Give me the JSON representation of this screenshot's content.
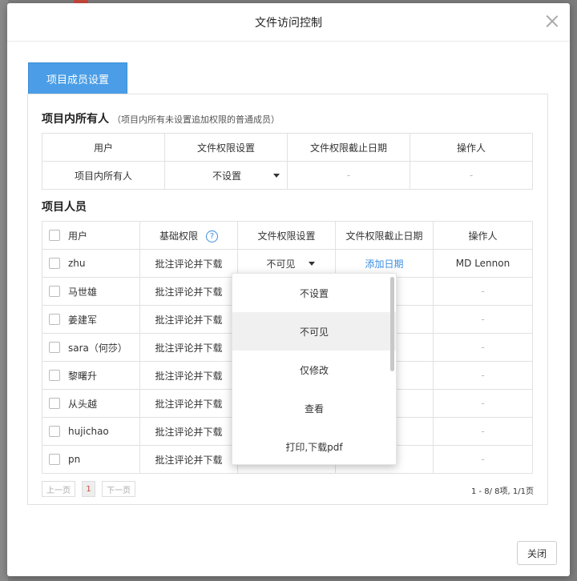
{
  "modal": {
    "title": "文件访问控制",
    "close_label": "关闭"
  },
  "tab": {
    "label": "项目成员设置"
  },
  "owner_section": {
    "title": "项目内所有人",
    "note": "（项目内所有未设置追加权限的普通成员）",
    "headers": [
      "用户",
      "文件权限设置",
      "文件权限截止日期",
      "操作人"
    ],
    "row": {
      "user": "项目内所有人",
      "permission": "不设置",
      "deadline": "-",
      "operator": "-"
    }
  },
  "members_section": {
    "title": "项目人员",
    "headers": {
      "user": "用户",
      "base": "基础权限",
      "help": "?",
      "perm": "文件权限设置",
      "deadline": "文件权限截止日期",
      "operator": "操作人"
    },
    "rows": [
      {
        "name": "zhu",
        "base": "批注评论并下载",
        "perm": "不可见",
        "deadline": "添加日期",
        "operator": "MD Lennon"
      },
      {
        "name": "马世雄",
        "base": "批注评论并下载",
        "operator": "-"
      },
      {
        "name": "姜建军",
        "base": "批注评论并下载",
        "operator": "-"
      },
      {
        "name": "sara（何莎）",
        "base": "批注评论并下载",
        "operator": "-"
      },
      {
        "name": "黎曙升",
        "base": "批注评论并下载",
        "operator": "-"
      },
      {
        "name": "从头越",
        "base": "批注评论并下载",
        "operator": "-"
      },
      {
        "name": "hujichao",
        "base": "批注评论并下载",
        "operator": "-"
      },
      {
        "name": "pn",
        "base": "批注评论并下载",
        "operator": "-"
      }
    ]
  },
  "pager": {
    "prev": "上一页",
    "page": "1",
    "next": "下一页",
    "summary": "1 - 8/ 8项, 1/1页"
  },
  "dropdown": {
    "options": [
      "不设置",
      "不可见",
      "仅修改",
      "查看",
      "打印,下载pdf"
    ],
    "selected": "不可见"
  },
  "colors": {
    "accent": "#4a9de6",
    "link": "#3b8ee0",
    "page_red": "#c94a3c"
  }
}
